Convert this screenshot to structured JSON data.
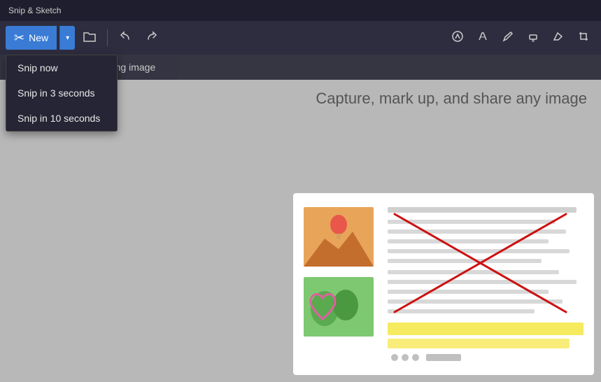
{
  "titleBar": {
    "title": "Snip & Sketch"
  },
  "toolbar": {
    "newLabel": "New",
    "dropdownArrow": "▾",
    "undoIcon": "↩",
    "redoIcon": "↪",
    "openIcon": "🗂",
    "touchWriteIcon": "✏",
    "ballpointIcon": "✒",
    "pencilIcon": "✏",
    "highlighterIcon": "▌",
    "eraserIcon": "⌫",
    "cropIcon": "⊡"
  },
  "dropdown": {
    "items": [
      {
        "label": "Snip now",
        "id": "snip-now"
      },
      {
        "label": "Snip in 3 seconds",
        "id": "snip-3"
      },
      {
        "label": "Snip in 10 seconds",
        "id": "snip-10"
      }
    ]
  },
  "mainContent": {
    "promptText": "screen or open an existing image",
    "centerText": "Capture, mark up, and share any image"
  }
}
